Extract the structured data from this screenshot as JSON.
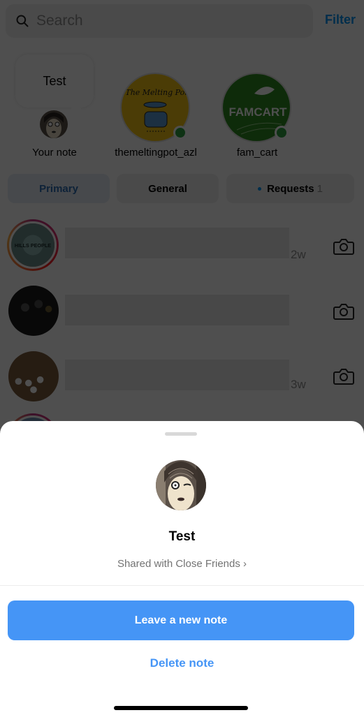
{
  "search": {
    "placeholder": "Search",
    "icon": "search-icon"
  },
  "header": {
    "filter_label": "Filter"
  },
  "notes": {
    "bubble_text": "Test",
    "items": [
      {
        "label": "Your note",
        "online": false
      },
      {
        "label": "themeltingpot_azl",
        "online": true,
        "avatar_text": "The Melting Pot"
      },
      {
        "label": "fam_cart",
        "online": true,
        "avatar_text": "FAMCART"
      }
    ]
  },
  "tabs": [
    {
      "label": "Primary",
      "active": true
    },
    {
      "label": "General",
      "active": false
    },
    {
      "label": "Requests",
      "count": "1",
      "active": false
    }
  ],
  "threads": [
    {
      "avatar_text": "HILLS PEOPLE",
      "time": "2w",
      "has_story_ring": true
    },
    {
      "avatar_text": "",
      "time": "",
      "has_story_ring": false
    },
    {
      "avatar_text": "",
      "time": "3w",
      "has_story_ring": false
    }
  ],
  "sheet": {
    "note_text": "Test",
    "audience": "Shared with Close Friends ›",
    "primary_action": "Leave a new note",
    "secondary_action": "Delete note"
  },
  "colors": {
    "accent": "#4595f6",
    "online": "#2ea043"
  }
}
